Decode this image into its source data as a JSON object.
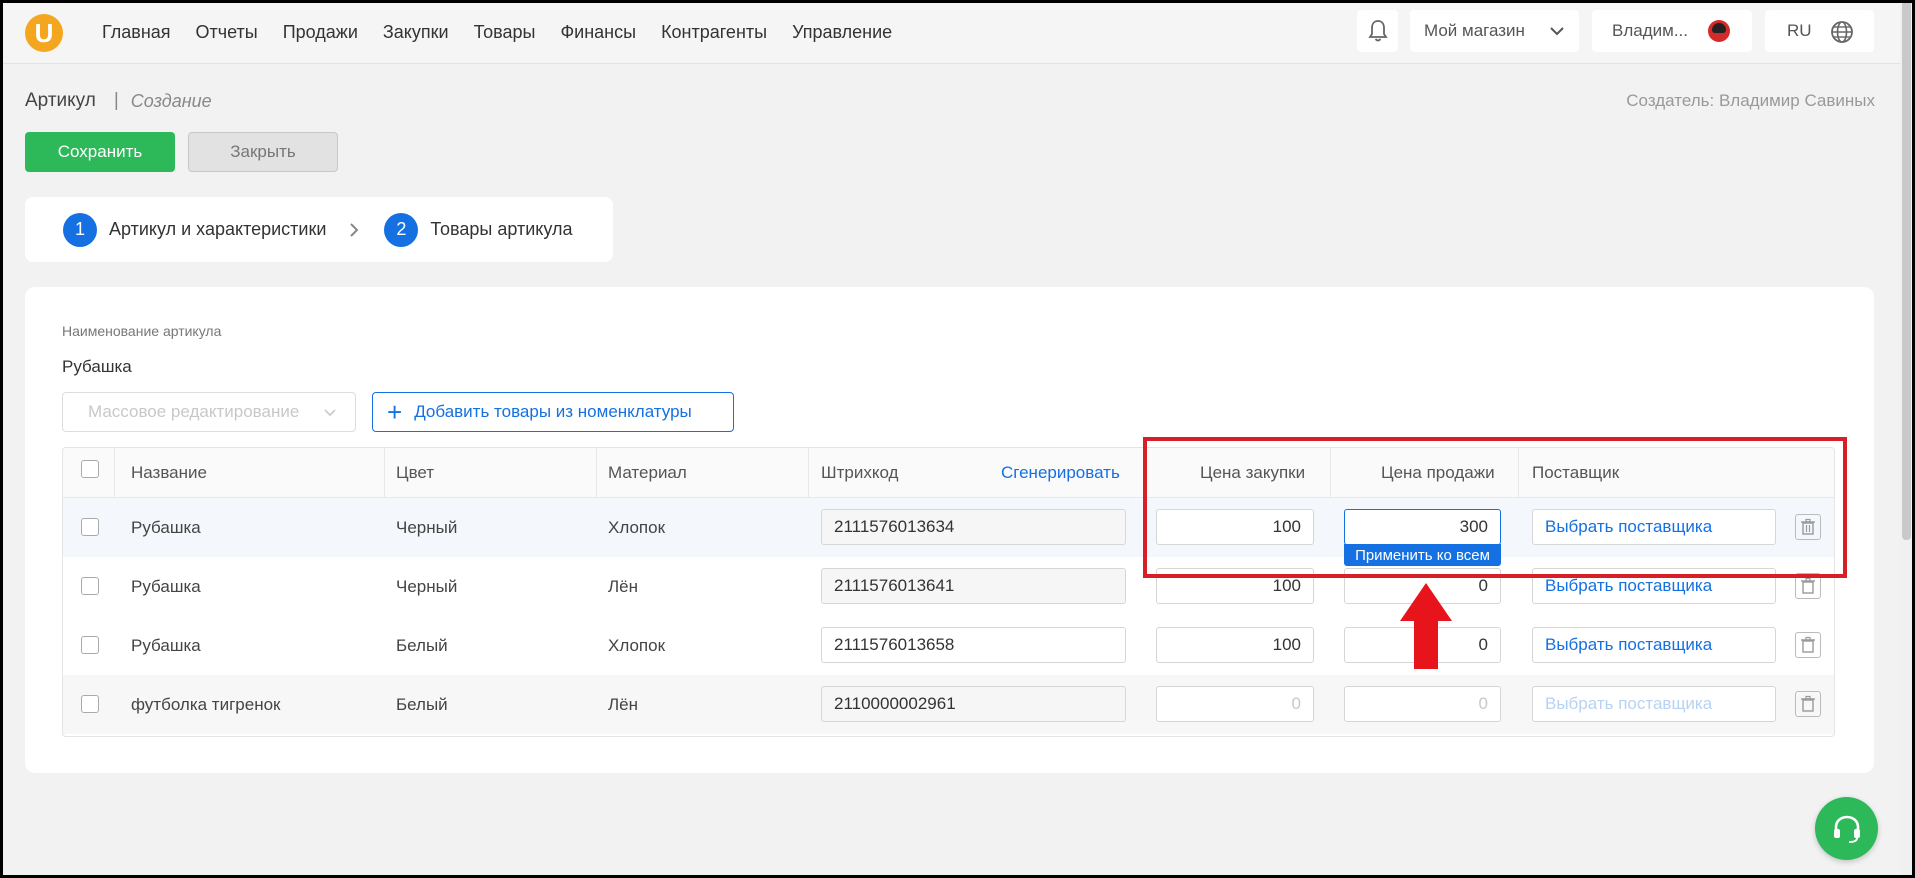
{
  "logo_letter": "U",
  "nav": [
    "Главная",
    "Отчеты",
    "Продажи",
    "Закупки",
    "Товары",
    "Финансы",
    "Контрагенты",
    "Управление"
  ],
  "topbar": {
    "store": "Мой магазин",
    "user": "Владим...",
    "lang": "RU"
  },
  "header": {
    "title": "Артикул",
    "separator": "|",
    "subtitle": "Создание",
    "creator": "Создатель: Владимир Савиных"
  },
  "actions": {
    "save": "Сохранить",
    "close": "Закрыть"
  },
  "steps": [
    {
      "num": "1",
      "label": "Артикул и характеристики"
    },
    {
      "num": "2",
      "label": "Товары артикула"
    }
  ],
  "form": {
    "name_label": "Наименование артикула",
    "name_value": "Рубашка",
    "mass_edit_placeholder": "Массовое редактирование",
    "add_goods": "Добавить товары из номенклатуры"
  },
  "table": {
    "headers": {
      "name": "Название",
      "color": "Цвет",
      "material": "Материал",
      "barcode": "Штрихкод",
      "generate": "Сгенерировать",
      "purchase_price": "Цена закупки",
      "sale_price": "Цена продажи",
      "supplier": "Поставщик"
    },
    "rows": [
      {
        "name": "Рубашка",
        "color": "Черный",
        "material": "Хлопок",
        "barcode": "2111576013634",
        "purchase_price": "100",
        "sale_price": "300",
        "supplier": "Выбрать поставщика"
      },
      {
        "name": "Рубашка",
        "color": "Черный",
        "material": "Лён",
        "barcode": "2111576013641",
        "purchase_price": "100",
        "sale_price": "0",
        "supplier": "Выбрать поставщика"
      },
      {
        "name": "Рубашка",
        "color": "Белый",
        "material": "Хлопок",
        "barcode": "2111576013658",
        "purchase_price": "100",
        "sale_price": "0",
        "supplier": "Выбрать поставщика"
      },
      {
        "name": "футболка тигренок",
        "color": "Белый",
        "material": "Лён",
        "barcode": "2110000002961",
        "purchase_price": "0",
        "sale_price": "0",
        "supplier": "Выбрать поставщика"
      }
    ],
    "apply_all": "Применить ко всем"
  },
  "colors": {
    "accent": "#1570e2",
    "save": "#2db85a",
    "annotation": "#d61f27",
    "logo": "#f5a61f"
  }
}
